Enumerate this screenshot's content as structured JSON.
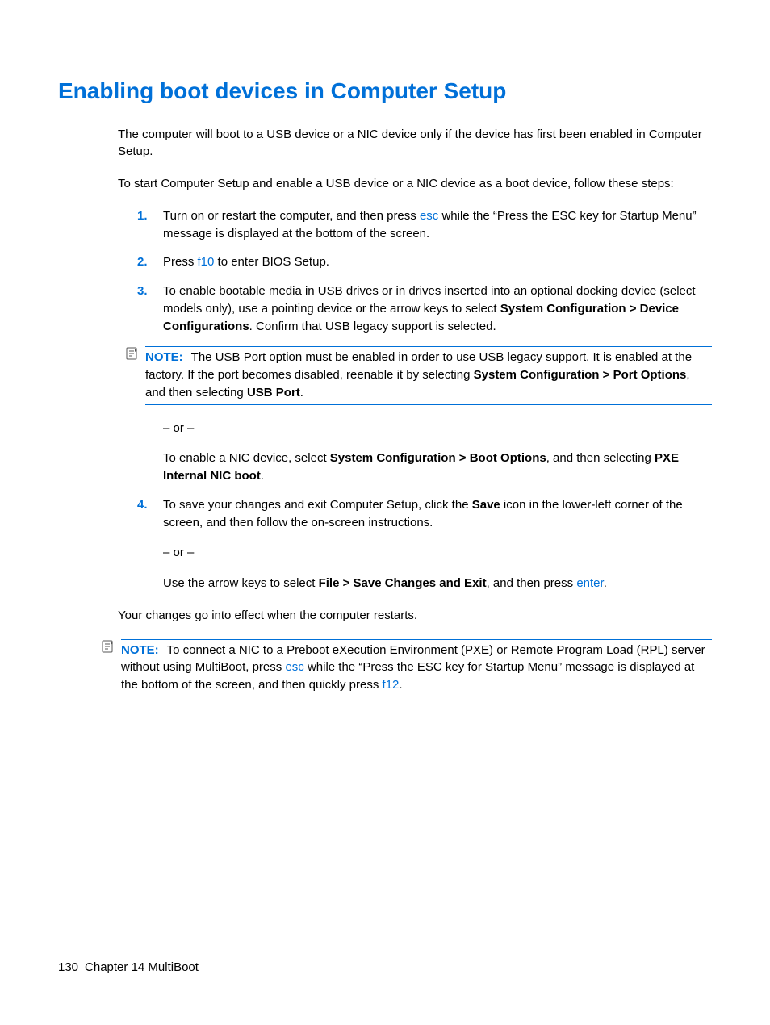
{
  "heading": "Enabling boot devices in Computer Setup",
  "intro1": "The computer will boot to a USB device or a NIC device only if the device has first been enabled in Computer Setup.",
  "intro2": "To start Computer Setup and enable a USB device or a NIC device as a boot device, follow these steps:",
  "steps": {
    "s1_a": "Turn on or restart the computer, and then press ",
    "s1_key": "esc",
    "s1_b": " while the “Press the ESC key for Startup Menu” message is displayed at the bottom of the screen.",
    "s2_a": "Press ",
    "s2_key": "f10",
    "s2_b": " to enter BIOS Setup.",
    "s3_a": "To enable bootable media in USB drives or in drives inserted into an optional docking device (select models only), use a pointing device or the arrow keys to select ",
    "s3_bold1": "System Configuration > Device Configurations",
    "s3_b": ". Confirm that USB legacy support is selected.",
    "s3_note_label": "NOTE:",
    "s3_note_a": "The USB Port option must be enabled in order to use USB legacy support. It is enabled at the factory. If the port becomes disabled, reenable it by selecting ",
    "s3_note_bold1": "System Configuration > Port Options",
    "s3_note_b": ", and then selecting ",
    "s3_note_bold2": "USB Port",
    "s3_note_c": ".",
    "s3_or": "– or –",
    "s3_sub_a": "To enable a NIC device, select ",
    "s3_sub_bold1": "System Configuration > Boot Options",
    "s3_sub_b": ", and then selecting ",
    "s3_sub_bold2": "PXE Internal NIC boot",
    "s3_sub_c": ".",
    "s4_a": "To save your changes and exit Computer Setup, click the ",
    "s4_bold1": "Save",
    "s4_b": " icon in the lower-left corner of the screen, and then follow the on-screen instructions.",
    "s4_or": "– or –",
    "s4_sub_a": "Use the arrow keys to select ",
    "s4_sub_bold1": "File > Save Changes and Exit",
    "s4_sub_b": ", and then press ",
    "s4_sub_key": "enter",
    "s4_sub_c": "."
  },
  "closing": "Your changes go into effect when the computer restarts.",
  "note2_label": "NOTE:",
  "note2_a": "To connect a NIC to a Preboot eXecution Environment (PXE) or Remote Program Load (RPL) server without using MultiBoot, press ",
  "note2_key1": "esc",
  "note2_b": " while the “Press the ESC key for Startup Menu” message is displayed at the bottom of the screen, and then quickly press ",
  "note2_key2": "f12",
  "note2_c": ".",
  "footer": {
    "page": "130",
    "chapter": "Chapter 14   MultiBoot"
  },
  "nums": {
    "n1": "1.",
    "n2": "2.",
    "n3": "3.",
    "n4": "4."
  }
}
